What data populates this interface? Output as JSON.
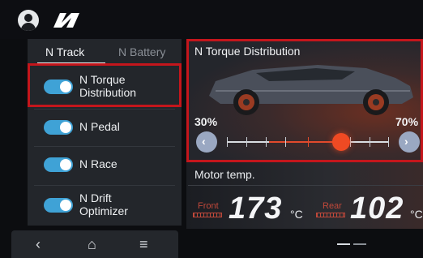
{
  "header": {
    "profile_icon": "person-icon",
    "brand_logo": "N"
  },
  "tabs": [
    {
      "label": "N Track",
      "active": true
    },
    {
      "label": "N Battery",
      "active": false
    }
  ],
  "items": [
    {
      "label": "N Torque\nDistribution",
      "enabled": true,
      "highlighted": true
    },
    {
      "label": "N Pedal",
      "enabled": true
    },
    {
      "label": "N Race",
      "enabled": true
    },
    {
      "label": "N Drift\nOptimizer",
      "enabled": true
    }
  ],
  "torque": {
    "title": "N Torque Distribution",
    "front_pct": "30%",
    "rear_pct": "70%",
    "value_fraction": 0.7
  },
  "motor": {
    "title": "Motor temp.",
    "front_label": "Front",
    "front_value": "173",
    "rear_label": "Rear",
    "rear_value": "102",
    "unit": "°C"
  },
  "nav": {
    "back": "‹",
    "home": "⌂",
    "menu": "≡"
  },
  "colors": {
    "accent_red": "#c4161c",
    "toggle_blue": "#3fa2d6",
    "slider_orange": "#ef4a23"
  }
}
